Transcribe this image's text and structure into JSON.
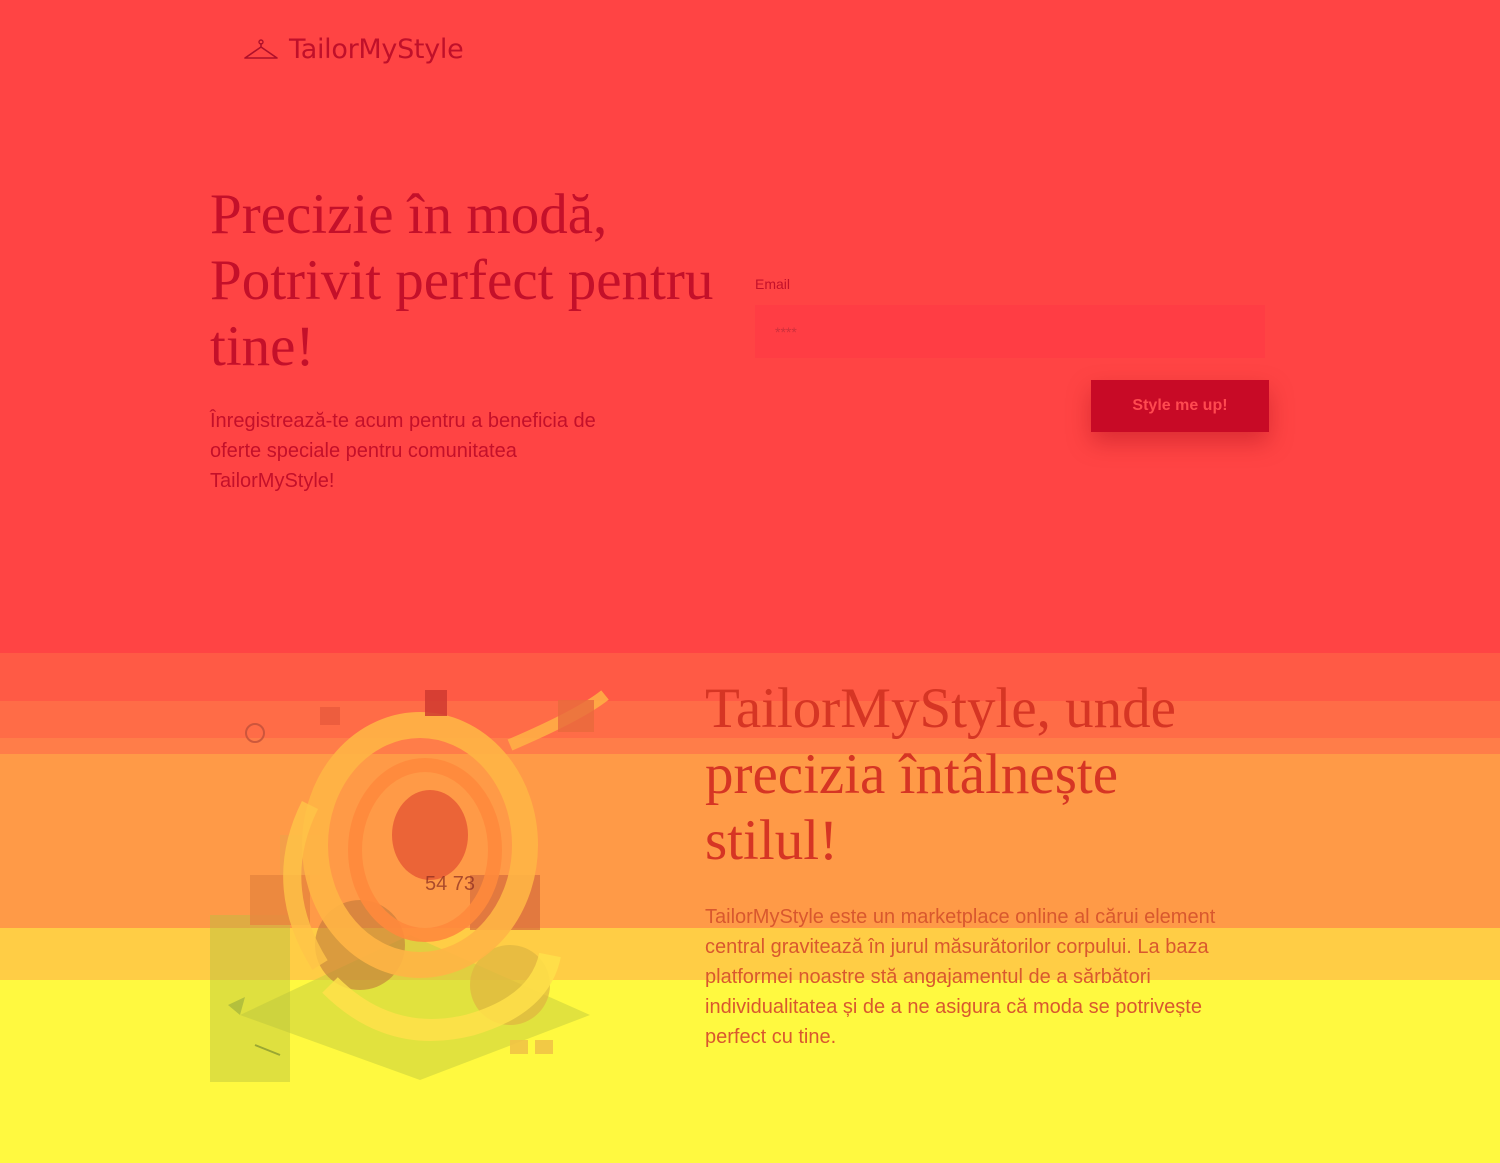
{
  "header": {
    "logo_text": "TailorMyStyle",
    "logo_icon": "hanger-icon"
  },
  "hero": {
    "title": "Precizie în modă, Potrivit perfect pentru tine!",
    "subtitle": "Înregistrează-te acum pentru a beneficia de oferte speciale pentru comunitatea TailorMyStyle!"
  },
  "signup_form": {
    "email_label": "Email",
    "email_placeholder": "****",
    "submit_label": "Style me up!"
  },
  "about": {
    "illustration": "measuring-tape-illustration",
    "title": "TailorMyStyle, unde precizia întâlnește stilul!",
    "text": "TailorMyStyle este un marketplace online al cărui element central gravitează în jurul măsurătorilor corpului. La baza platformei noastre stă angajamentul de a sărbători individualitatea și de a ne asigura că moda se potrivește perfect cu tine."
  },
  "colors": {
    "background": "#ff4444",
    "accent": "#c80a26",
    "heat_mid": "#ff9a47",
    "heat_low": "#fff940"
  }
}
